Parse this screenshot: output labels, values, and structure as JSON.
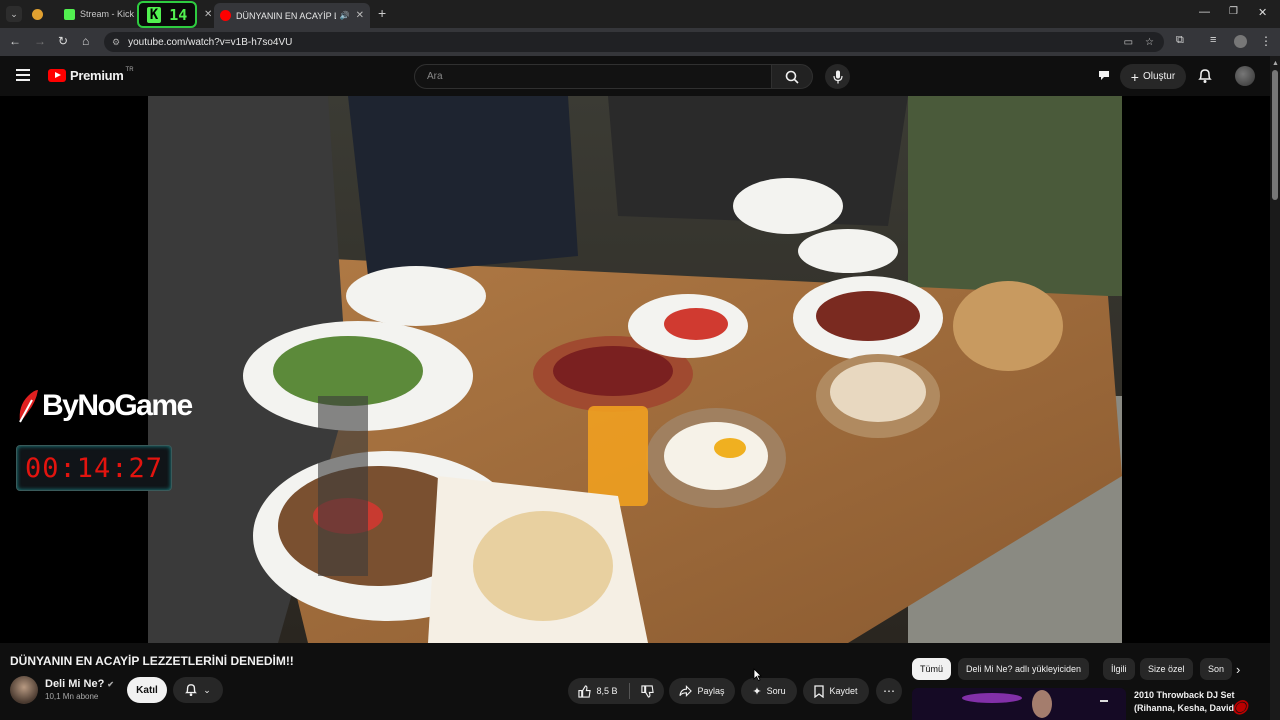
{
  "browser": {
    "tabs": [
      {
        "label": "",
        "active": false
      },
      {
        "label": "Stream - Kick Da",
        "active": false
      },
      {
        "label": "DÜNYANIN EN ACAYİP LEZZ",
        "active": true
      }
    ],
    "kick_badge": {
      "letter": "K",
      "count": "14"
    },
    "url": "youtube.com/watch?v=v1B-h7so4VU"
  },
  "youtube": {
    "logo_word": "Premium",
    "logo_country": "TR",
    "search_placeholder": "Ara",
    "create_label": "Oluştur"
  },
  "overlay": {
    "brand": "ByNoGame",
    "timer": "00:14:27"
  },
  "video": {
    "title": "DÜNYANIN EN ACAYİP LEZZETLERİNİ DENEDİM!!",
    "channel": "Deli Mi Ne?",
    "subscribers": "10,1 Mn abone",
    "join_label": "Katıl",
    "likes": "8,5 B",
    "share_label": "Paylaş",
    "ask_label": "Soru",
    "save_label": "Kaydet"
  },
  "chips": [
    "Tümü",
    "Deli Mi Ne? adlı yükleyiciden",
    "İlgili",
    "Size özel",
    "Son"
  ],
  "recommended": {
    "title": "2010 Throwback DJ Set (Rihanna, Kesha, David"
  },
  "colors": {
    "yt_red": "#ff0000",
    "timer_red": "#e3140f",
    "kick_green": "#52f050"
  }
}
